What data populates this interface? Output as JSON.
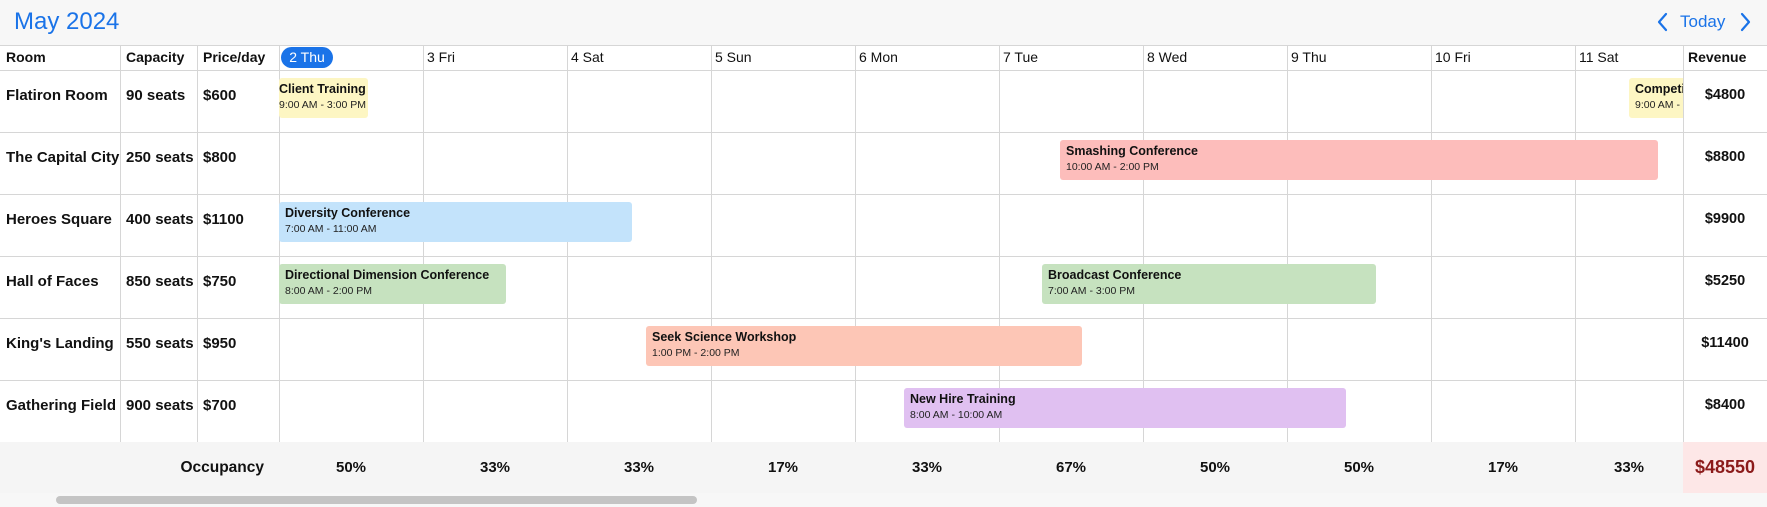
{
  "toolbar": {
    "month_title": "May 2024",
    "today_label": "Today",
    "prev_icon": "chevron-left-icon",
    "next_icon": "chevron-right-icon"
  },
  "columns": {
    "room": "Room",
    "capacity": "Capacity",
    "price": "Price/day",
    "revenue": "Revenue",
    "days": [
      "2 Thu",
      "3 Fri",
      "4 Sat",
      "5 Sun",
      "6 Mon",
      "7 Tue",
      "8 Wed",
      "9 Thu",
      "10 Fri",
      "11 Sat"
    ]
  },
  "rooms": [
    {
      "name": "Flatiron Room",
      "capacity": "90 seats",
      "price": "$600",
      "revenue": "$4800"
    },
    {
      "name": "The Capital City",
      "capacity": "250 seats",
      "price": "$800",
      "revenue": "$8800"
    },
    {
      "name": "Heroes Square",
      "capacity": "400 seats",
      "price": "$1100",
      "revenue": "$9900"
    },
    {
      "name": "Hall of Faces",
      "capacity": "850 seats",
      "price": "$750",
      "revenue": "$5250"
    },
    {
      "name": "King's Landing",
      "capacity": "550 seats",
      "price": "$950",
      "revenue": "$11400"
    },
    {
      "name": "Gathering Field",
      "capacity": "900 seats",
      "price": "$700",
      "revenue": "$8400"
    }
  ],
  "events": [
    {
      "title": "Client Training",
      "time": "9:00 AM - 3:00 PM",
      "color": "#fdf6c3"
    },
    {
      "title": "Competi",
      "time": "9:00 AM - 3",
      "color": "#fdf6c3"
    },
    {
      "title": "Smashing Conference",
      "time": "10:00 AM - 2:00 PM",
      "color": "#fdbdbb"
    },
    {
      "title": "Diversity Conference",
      "time": "7:00 AM - 11:00 AM",
      "color": "#c3e3fb"
    },
    {
      "title": "Directional Dimension Conference",
      "time": "8:00 AM - 2:00 PM",
      "color": "#c6e2bf"
    },
    {
      "title": "Broadcast Conference",
      "time": "7:00 AM - 3:00 PM",
      "color": "#c6e2bf"
    },
    {
      "title": "Seek Science Workshop",
      "time": "1:00 PM - 2:00 PM",
      "color": "#fdc6b6"
    },
    {
      "title": "New Hire Training",
      "time": "8:00 AM - 10:00 AM",
      "color": "#e0c0f1"
    }
  ],
  "occupancy": {
    "label": "Occupancy",
    "values": [
      "50%",
      "33%",
      "33%",
      "17%",
      "33%",
      "67%",
      "50%",
      "50%",
      "17%",
      "33%"
    ],
    "total": "$48550"
  },
  "colors": {
    "accent": "#1a73e8",
    "total_text": "#8b1a1a",
    "total_bg": "#fde7e7"
  }
}
